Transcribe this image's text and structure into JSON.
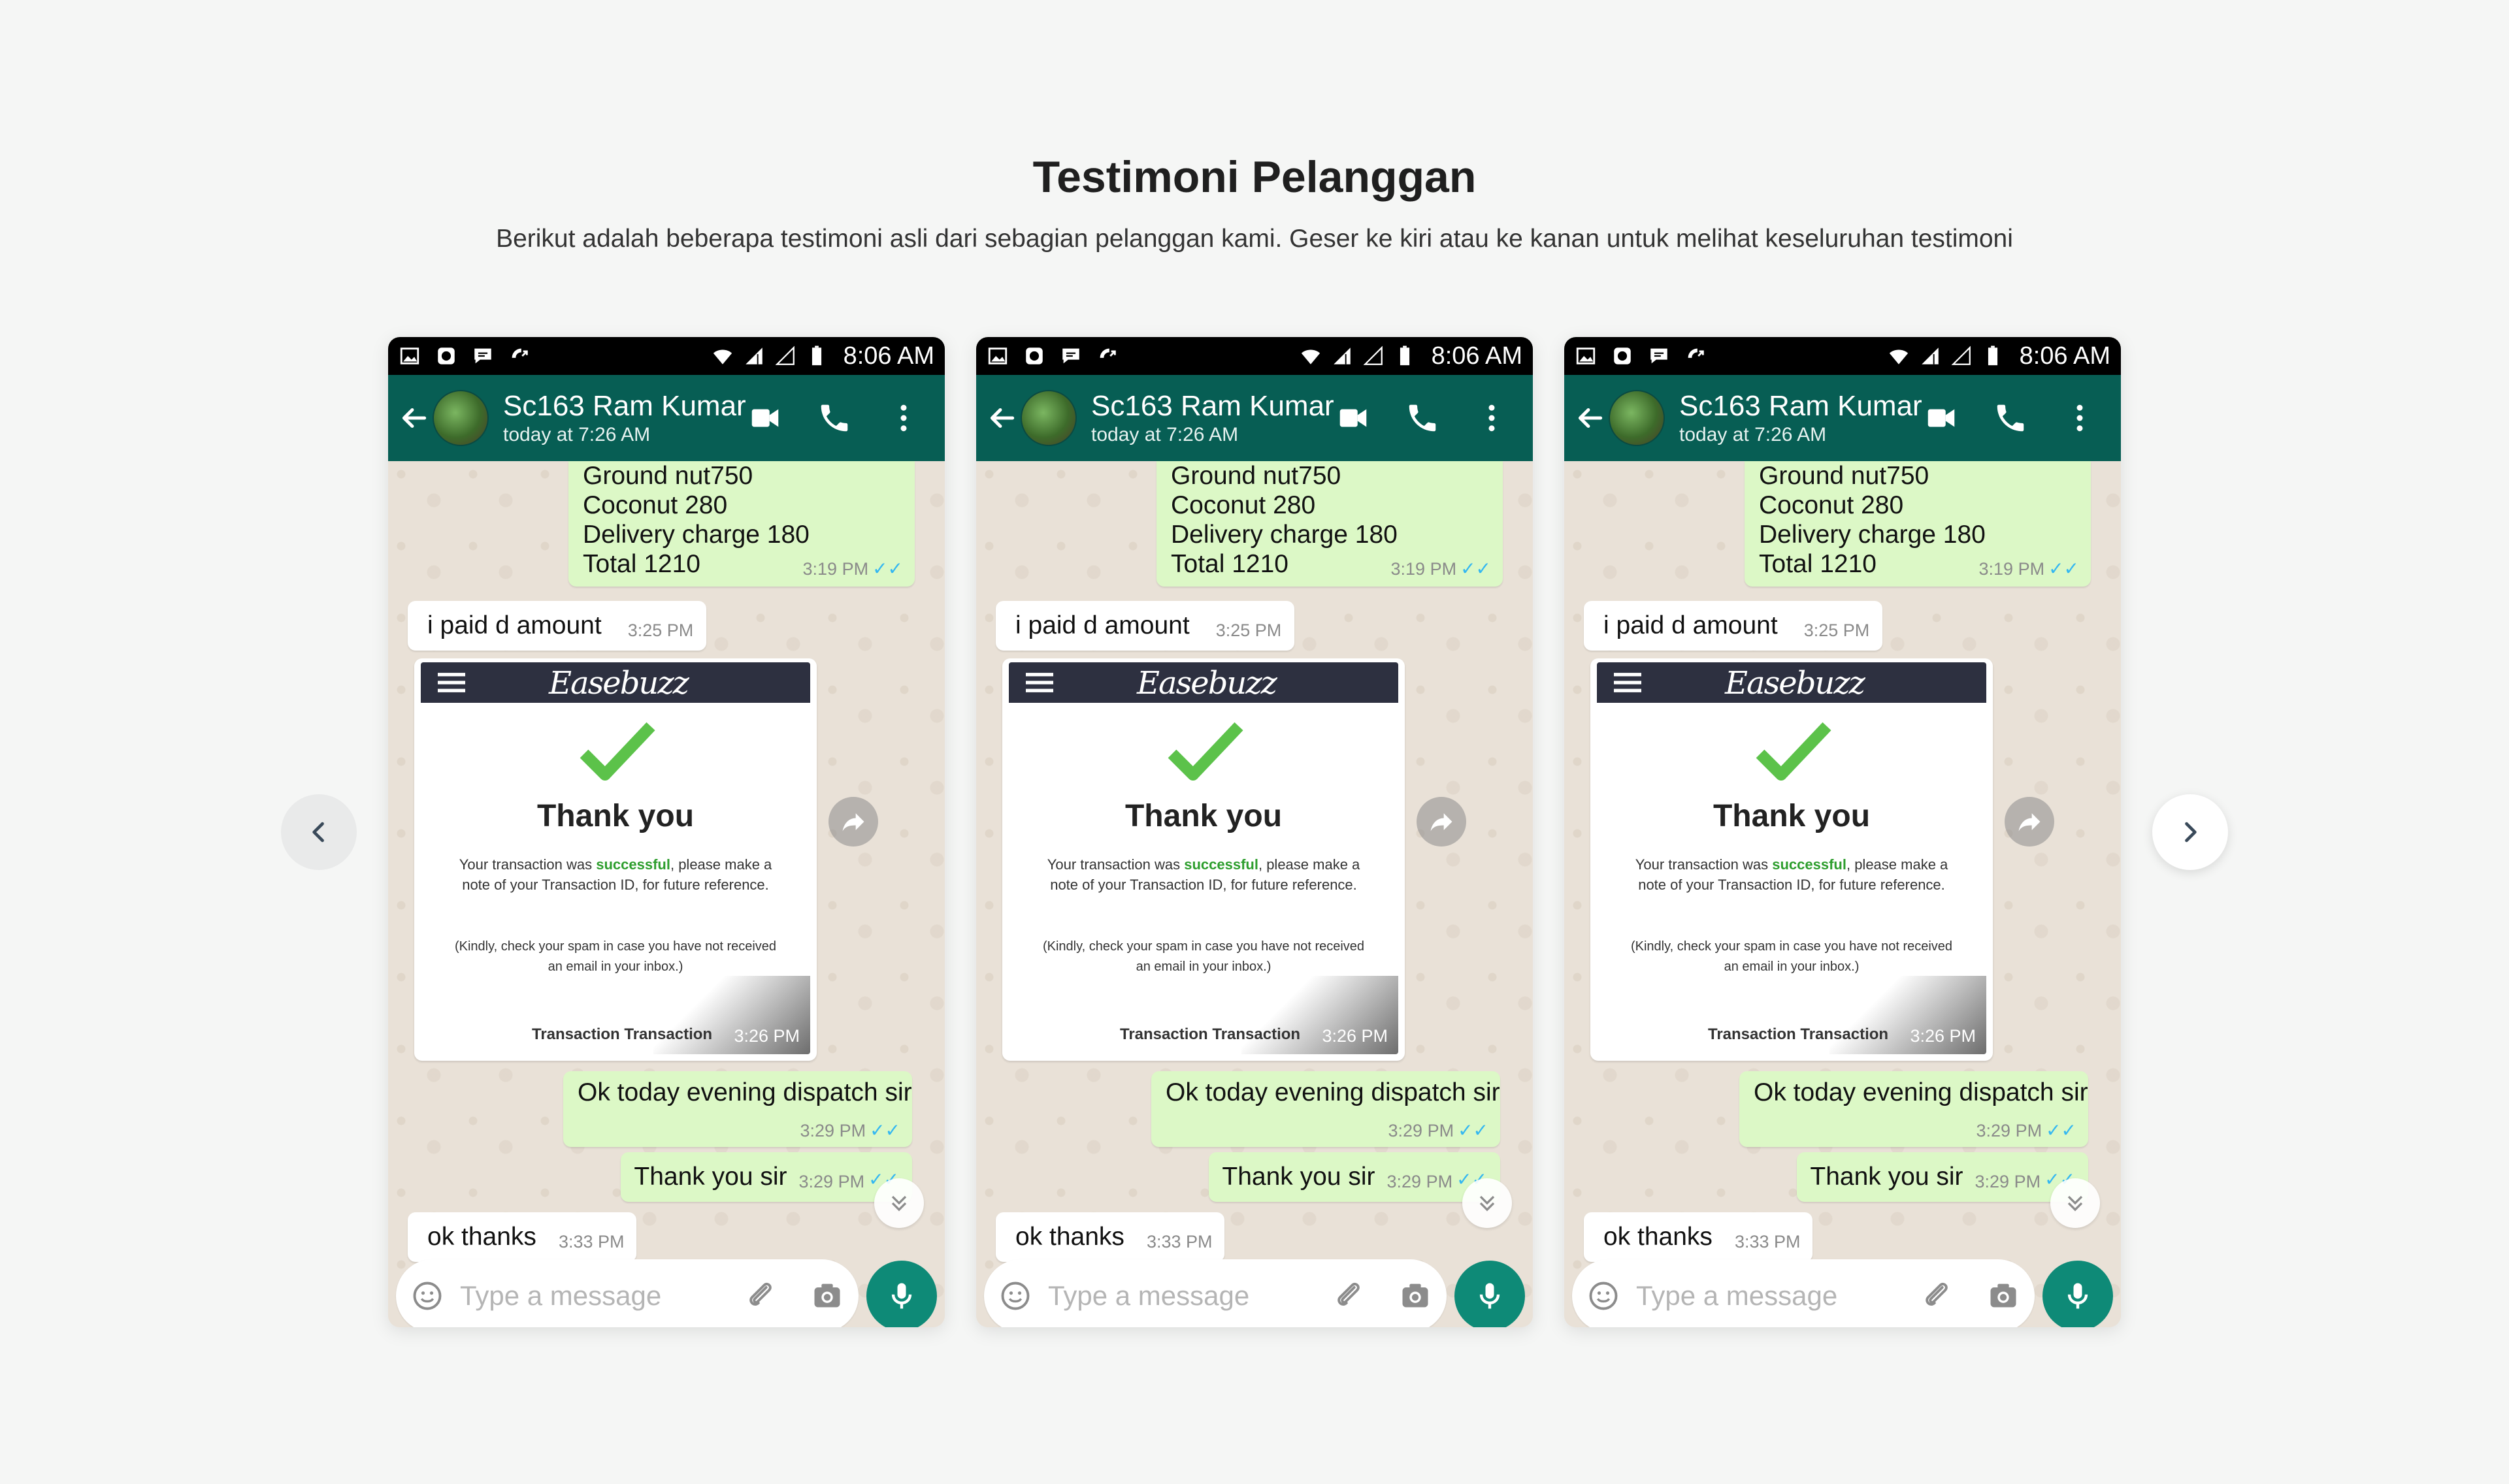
{
  "section": {
    "title": "Testimoni Pelanggan",
    "subtitle": "Berikut adalah beberapa testimoni asli dari sebagian pelanggan kami. Geser ke kiri atau ke kanan untuk melihat keseluruhan testimoni"
  },
  "nav": {
    "prev_icon": "chevron-left-icon",
    "next_icon": "chevron-right-icon"
  },
  "cards": [
    {
      "status_time": "8:06 AM",
      "contact_name": "Sc163 Ram Kumar",
      "contact_status": "today at 7:26 AM",
      "order_lines": [
        "Ground nut750",
        "Coconut 280",
        "Delivery charge 180",
        "Total 1210"
      ],
      "order_time": "3:19 PM",
      "msg_paid": "i paid d amount",
      "msg_paid_time": "3:25 PM",
      "receipt": {
        "logo": "Easebuzz",
        "heading": "Thank you",
        "line_pre": "Your transaction was ",
        "line_success": "successful",
        "line_post": ", please make a note of your Transaction ID, for future reference.",
        "note": "(Kindly, check your spam in case you have not received an email in your inbox.)",
        "footer": "Transaction  Transaction",
        "time": "3:26 PM"
      },
      "msg_dispatch": "Ok today evening dispatch sir",
      "msg_dispatch_time": "3:29 PM",
      "msg_thanks_sir": "Thank you sir",
      "msg_thanks_sir_time": "3:29 PM",
      "msg_ok": "ok thanks",
      "msg_ok_time": "3:33 PM",
      "input_placeholder": "Type a message"
    },
    {
      "status_time": "8:06 AM",
      "contact_name": "Sc163 Ram Kumar",
      "contact_status": "today at 7:26 AM",
      "order_lines": [
        "Ground nut750",
        "Coconut 280",
        "Delivery charge 180",
        "Total 1210"
      ],
      "order_time": "3:19 PM",
      "msg_paid": "i paid d amount",
      "msg_paid_time": "3:25 PM",
      "receipt": {
        "logo": "Easebuzz",
        "heading": "Thank you",
        "line_pre": "Your transaction was ",
        "line_success": "successful",
        "line_post": ", please make a note of your Transaction ID, for future reference.",
        "note": "(Kindly, check your spam in case you have not received an email in your inbox.)",
        "footer": "Transaction  Transaction",
        "time": "3:26 PM"
      },
      "msg_dispatch": "Ok today evening dispatch sir",
      "msg_dispatch_time": "3:29 PM",
      "msg_thanks_sir": "Thank you sir",
      "msg_thanks_sir_time": "3:29 PM",
      "msg_ok": "ok thanks",
      "msg_ok_time": "3:33 PM",
      "input_placeholder": "Type a message"
    },
    {
      "status_time": "8:06 AM",
      "contact_name": "Sc163 Ram Kumar",
      "contact_status": "today at 7:26 AM",
      "order_lines": [
        "Ground nut750",
        "Coconut 280",
        "Delivery charge 180",
        "Total 1210"
      ],
      "order_time": "3:19 PM",
      "msg_paid": "i paid d amount",
      "msg_paid_time": "3:25 PM",
      "receipt": {
        "logo": "Easebuzz",
        "heading": "Thank you",
        "line_pre": "Your transaction was ",
        "line_success": "successful",
        "line_post": ", please make a note of your Transaction ID, for future reference.",
        "note": "(Kindly, check your spam in case you have not received an email in your inbox.)",
        "footer": "Transaction  Transaction",
        "time": "3:26 PM"
      },
      "msg_dispatch": "Ok today evening dispatch sir",
      "msg_dispatch_time": "3:29 PM",
      "msg_thanks_sir": "Thank you sir",
      "msg_thanks_sir_time": "3:29 PM",
      "msg_ok": "ok thanks",
      "msg_ok_time": "3:33 PM",
      "input_placeholder": "Type a message"
    }
  ],
  "colors": {
    "header_green": "#075e54",
    "outgoing_bubble": "#dcf8c6",
    "mic_button": "#0e8a77",
    "read_ticks": "#34b7f1"
  }
}
